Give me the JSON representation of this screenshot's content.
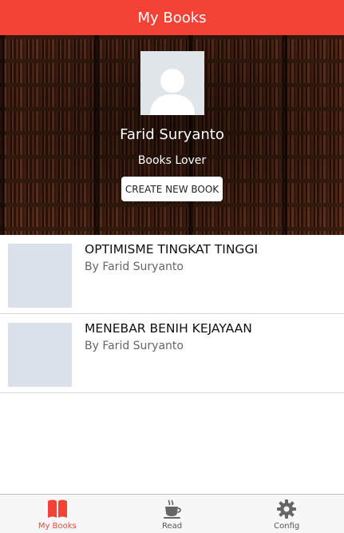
{
  "header": {
    "title": "My Books"
  },
  "profile": {
    "name": "Farid Suryanto",
    "bio": "Books Lover",
    "create_button_label": "CREATE NEW BOOK"
  },
  "books": [
    {
      "title": "OPTIMISME TINGKAT TINGGI",
      "author": "By Farid Suryanto"
    },
    {
      "title": "MENEBAR BENIH KEJAYAAN",
      "author": "By Farid Suryanto"
    }
  ],
  "tabs": [
    {
      "label": "My Books",
      "icon": "book-icon",
      "active": true
    },
    {
      "label": "Read",
      "icon": "coffee-cup-icon",
      "active": false
    },
    {
      "label": "Config",
      "icon": "gear-icon",
      "active": false
    }
  ],
  "colors": {
    "accent": "#f44336",
    "placeholder": "#dae1ea",
    "inactive_icon": "#666666"
  }
}
